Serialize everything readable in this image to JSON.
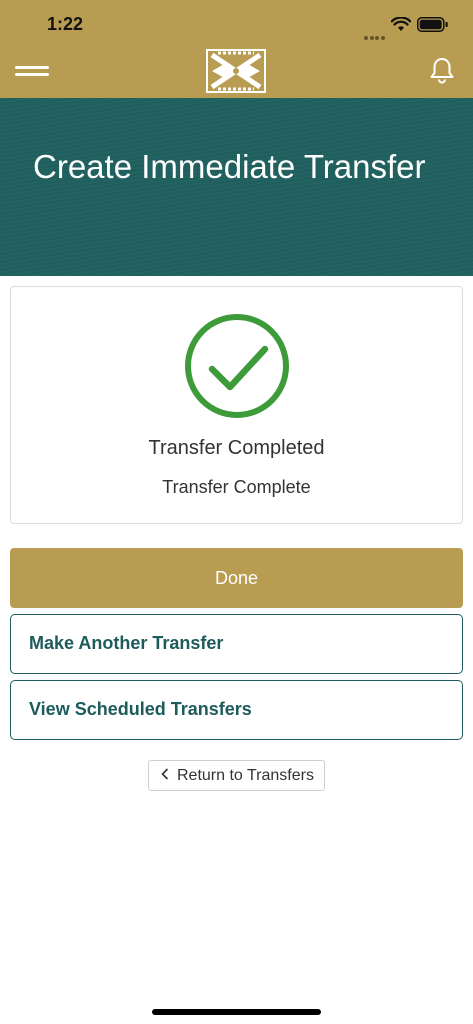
{
  "status_bar": {
    "time": "1:22"
  },
  "header": {
    "menu_icon": "hamburger-icon",
    "logo_icon": "bank-logo-icon",
    "bell_icon": "bell-icon"
  },
  "banner": {
    "title": "Create Immediate Transfer"
  },
  "result": {
    "icon": "check-circle-icon",
    "title": "Transfer Completed",
    "subtitle": "Transfer Complete",
    "success_color": "#3e9b3a"
  },
  "actions": {
    "done_label": "Done",
    "another_label": "Make Another Transfer",
    "scheduled_label": "View Scheduled Transfers",
    "return_label": "Return to Transfers"
  },
  "colors": {
    "brand_gold": "#b89c52",
    "brand_teal": "#1d5b5c"
  }
}
